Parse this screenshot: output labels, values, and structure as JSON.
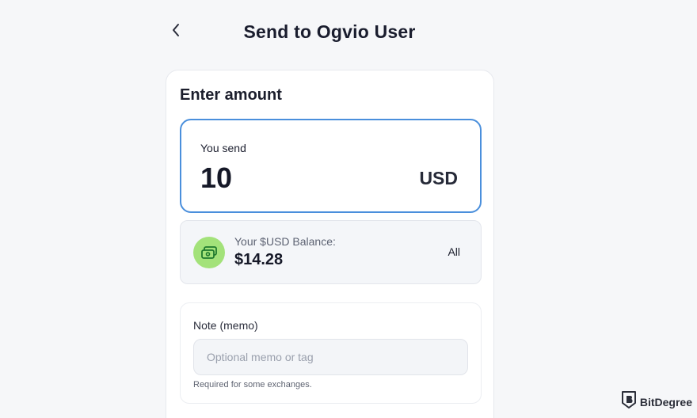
{
  "header": {
    "title": "Send to Ogvio User",
    "back_icon": "chevron-left-icon"
  },
  "card": {
    "title": "Enter amount",
    "send": {
      "label": "You send",
      "amount": "10",
      "currency": "USD"
    },
    "balance": {
      "icon": "cash-icon",
      "label": "Your $USD Balance:",
      "value": "$14.28",
      "all_label": "All"
    },
    "memo": {
      "label": "Note (memo)",
      "placeholder": "Optional memo or tag",
      "helper": "Required for some exchanges."
    }
  },
  "watermark": {
    "text": "BitDegree"
  },
  "colors": {
    "accent_border": "#4a8fdc",
    "balance_icon_bg": "#a3e27a",
    "page_bg": "#f6f7f9"
  }
}
